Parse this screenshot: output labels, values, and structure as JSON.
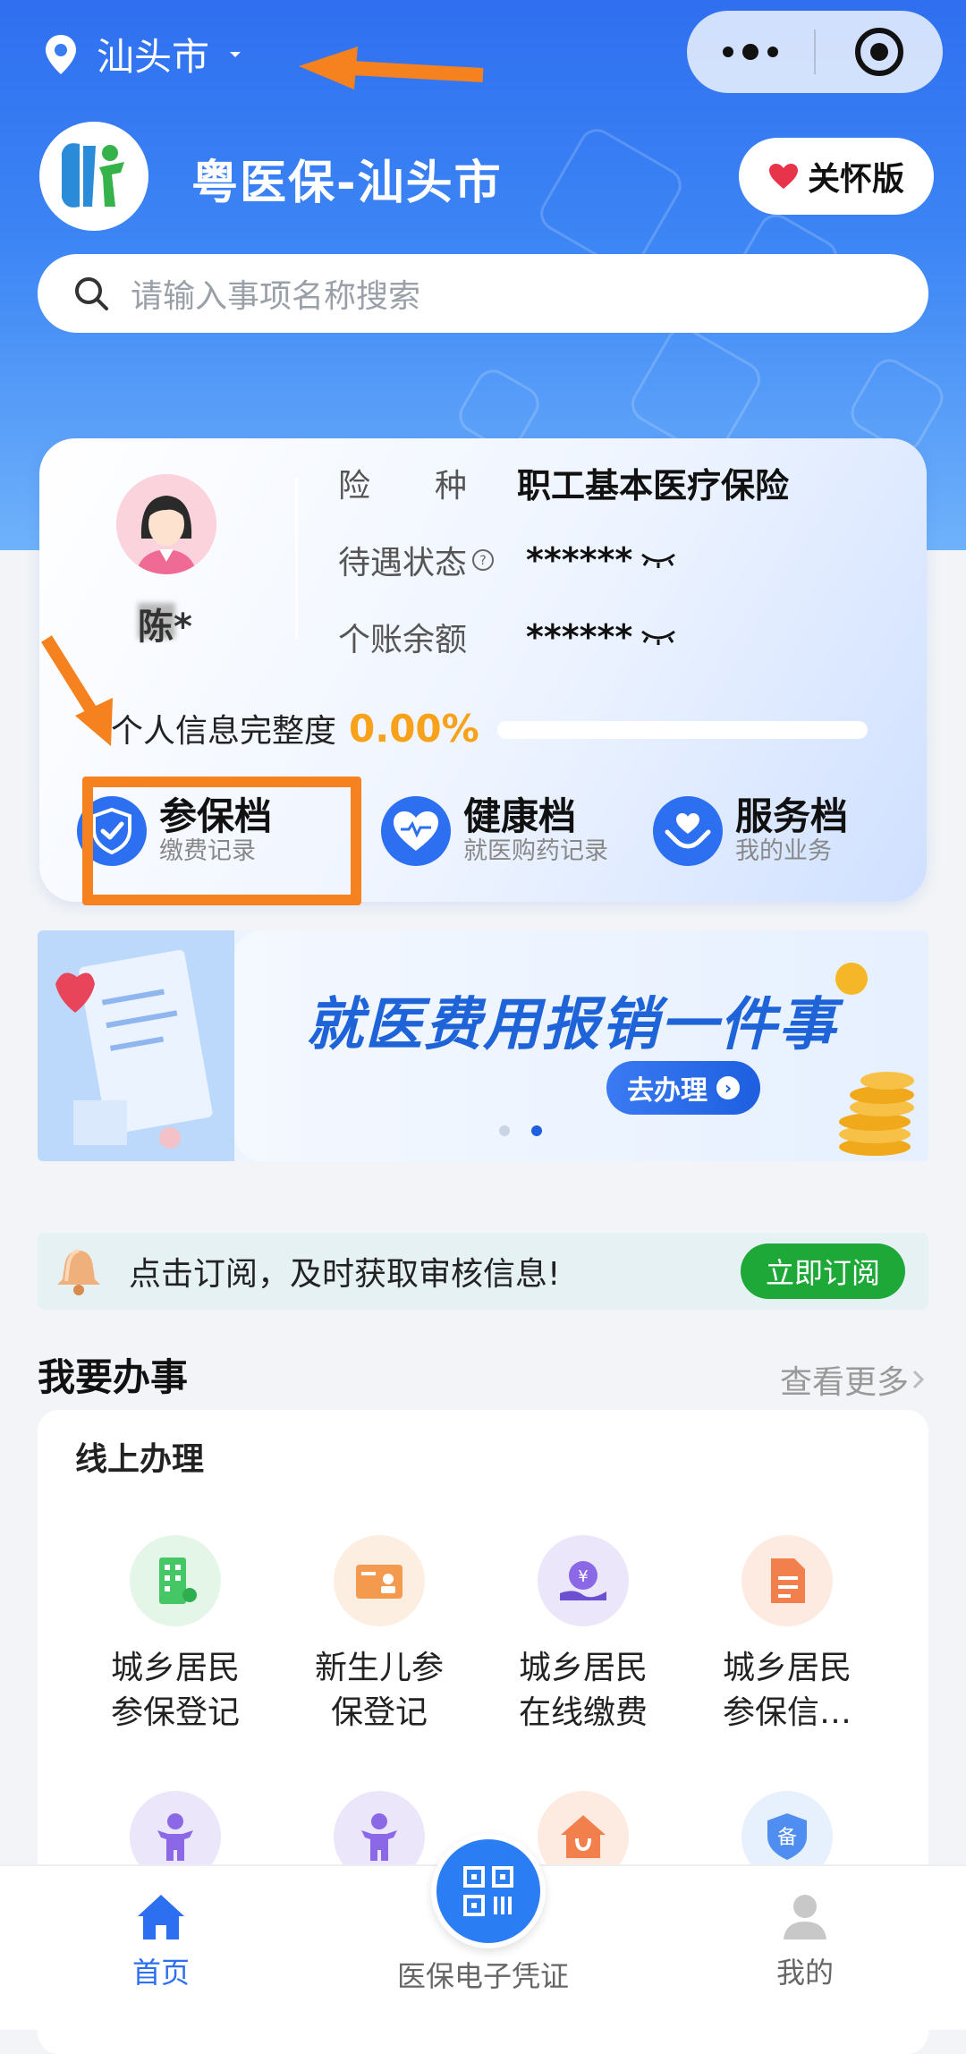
{
  "header": {
    "city": "汕头市",
    "app_name": "粤医保-汕头市",
    "care_mode_label": "关怀版",
    "search_placeholder": "请输入事项名称搜索"
  },
  "user_card": {
    "username": "陈*",
    "insurance_type_label": "险　　种",
    "insurance_type_value": "职工基本医疗保险",
    "benefit_status_label": "待遇状态",
    "benefit_status_value": "******",
    "account_balance_label": "个账余额",
    "account_balance_value": "******",
    "completeness_label": "个人信息完整度",
    "completeness_value": "0.00%",
    "completeness_fraction": 0.0,
    "archives": [
      {
        "title": "参保档",
        "subtitle": "缴费记录"
      },
      {
        "title": "健康档",
        "subtitle": "就医购药记录"
      },
      {
        "title": "服务档",
        "subtitle": "我的业务"
      }
    ]
  },
  "banner": {
    "title": "就医费用报销一件事",
    "button_label": "去办理"
  },
  "notice": {
    "text": "点击订阅，及时获取审核信息!",
    "button_label": "立即订阅"
  },
  "services": {
    "section_title": "我要办事",
    "more_label": "查看更多",
    "panel_title": "线上办理",
    "items": [
      {
        "line1": "城乡居民",
        "line2": "参保登记",
        "icon": "building-icon"
      },
      {
        "line1": "新生儿参",
        "line2": "保登记",
        "icon": "id-card-icon"
      },
      {
        "line1": "城乡居民",
        "line2": "在线缴费",
        "icon": "payment-hand-icon"
      },
      {
        "line1": "城乡居民",
        "line2": "参保信…",
        "icon": "document-icon"
      },
      {
        "icon": "child-icon"
      },
      {
        "icon": "child-icon"
      },
      {
        "icon": "house-medical-icon"
      },
      {
        "icon": "shield-bei-icon",
        "badge": "备"
      }
    ]
  },
  "tabbar": {
    "home": "首页",
    "qr": "医保电子凭证",
    "mine": "我的"
  },
  "colors": {
    "primary": "#2c6ff0",
    "accent_orange": "#f5821f",
    "subscribe_green": "#1ea838",
    "percent_orange": "#f7a21a"
  }
}
